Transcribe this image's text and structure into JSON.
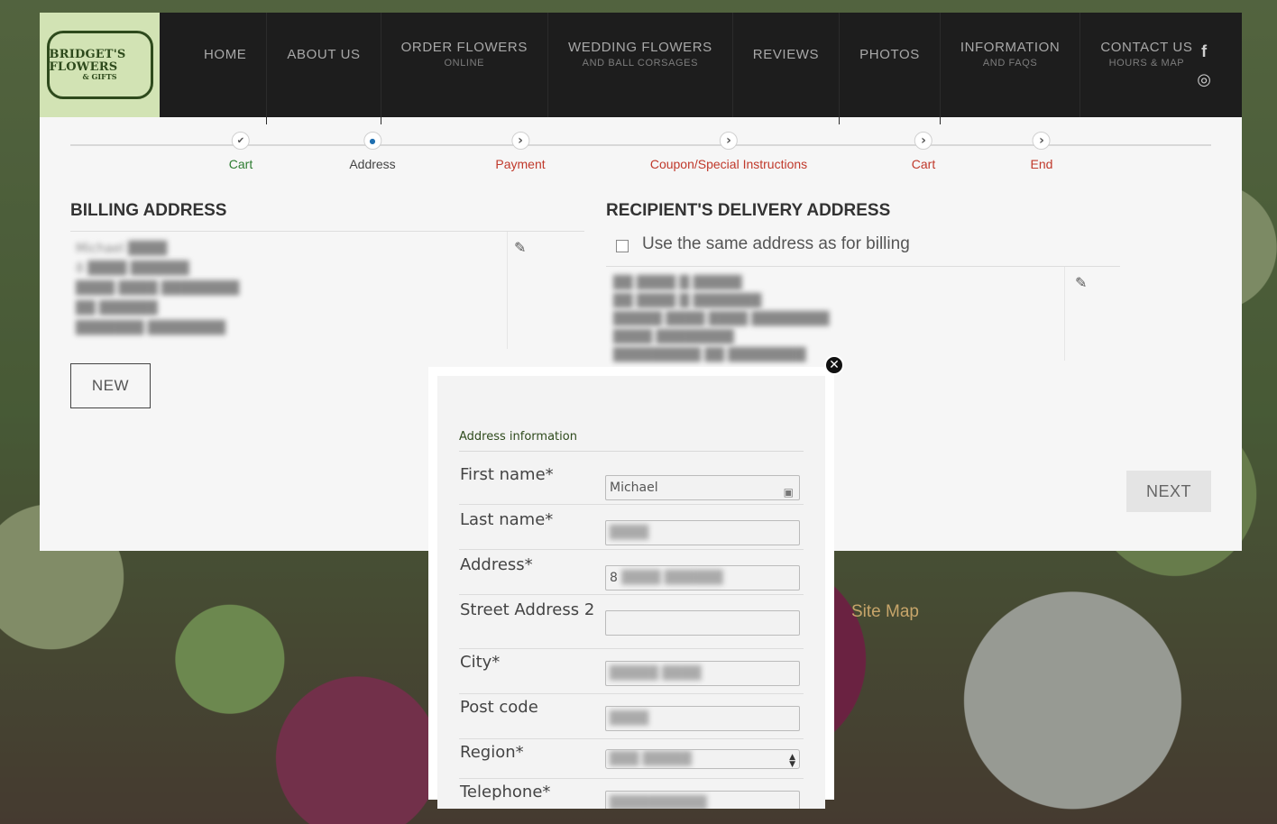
{
  "logo": {
    "main": "BRIDGET'S FLOWERS",
    "sub": "& GIFTS"
  },
  "nav": [
    {
      "label": "HOME",
      "sub": ""
    },
    {
      "label": "ABOUT US",
      "sub": ""
    },
    {
      "label": "ORDER FLOWERS",
      "sub": "ONLINE"
    },
    {
      "label": "WEDDING FLOWERS",
      "sub": "AND BALL CORSAGES"
    },
    {
      "label": "REVIEWS",
      "sub": ""
    },
    {
      "label": "PHOTOS",
      "sub": ""
    },
    {
      "label": "INFORMATION",
      "sub": "AND FAQS"
    },
    {
      "label": "CONTACT US",
      "sub": "HOURS & MAP"
    }
  ],
  "social": {
    "facebook": "f",
    "instagram": "◎"
  },
  "steps": [
    {
      "label": "Cart",
      "state": "done",
      "color": "#2e7d32",
      "glyph": "✔"
    },
    {
      "label": "Address",
      "state": "current",
      "color": "#444444",
      "glyph": "●"
    },
    {
      "label": "Payment",
      "state": "todo",
      "color": "#c0392b",
      "glyph": "›"
    },
    {
      "label": "Coupon/Special Instructions",
      "state": "todo",
      "color": "#c0392b",
      "glyph": "›"
    },
    {
      "label": "Cart",
      "state": "todo",
      "color": "#c0392b",
      "glyph": "›"
    },
    {
      "label": "End",
      "state": "todo",
      "color": "#c0392b",
      "glyph": "›"
    }
  ],
  "billing": {
    "title": "BILLING ADDRESS",
    "lines": [
      "Michael ████",
      "8 ████ ██████",
      "████ ████ ████████",
      "██ ██████",
      "███████ ████████"
    ],
    "new_label": "NEW"
  },
  "delivery": {
    "title": "RECIPIENT'S DELIVERY ADDRESS",
    "same_label": "Use the same address as for billing",
    "lines": [
      "██ ████ █ █████",
      "██ ████ █ ███████",
      "█████ ████ ████ ████████",
      "████ ████████",
      "█████████ ██ ████████"
    ]
  },
  "next_label": "NEXT",
  "footer": {
    "sitemap": "Site Map"
  },
  "modal": {
    "close": "✕",
    "section_title": "Address information",
    "fields": [
      {
        "label": "First name*",
        "value": "Michael",
        "blurred": false
      },
      {
        "label": "Last name*",
        "value": "████",
        "blurred": true
      },
      {
        "label": "Address*",
        "value": "8",
        "value_blur": "████ ██████",
        "blurred": false
      },
      {
        "label": "Street Address 2",
        "value": "",
        "blurred": false
      },
      {
        "label": "City*",
        "value": "█████ ████",
        "blurred": true
      },
      {
        "label": "Post code",
        "value": "████",
        "blurred": true
      },
      {
        "label": "Region*",
        "value": "███ █████",
        "blurred": true
      },
      {
        "label": "Telephone*",
        "value": "██████████",
        "blurred": true
      }
    ]
  }
}
